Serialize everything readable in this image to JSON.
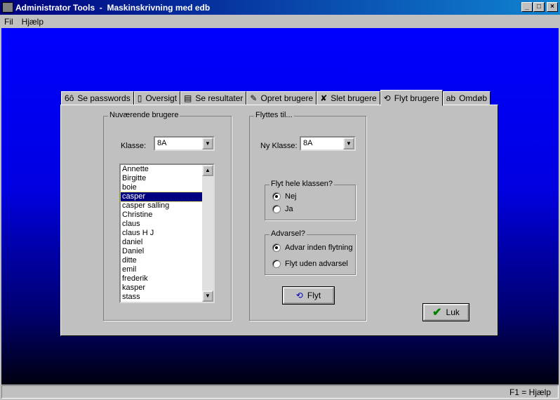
{
  "window": {
    "title": "Administrator Tools  -  Maskinskrivning med edb",
    "min": "_",
    "max": "□",
    "close": "×"
  },
  "menu": [
    "Fil",
    "Hjælp"
  ],
  "tabs": [
    {
      "label": "Se passwords",
      "icon": "glasses-icon",
      "glyph": "6ô"
    },
    {
      "label": "Oversigt",
      "icon": "document-icon",
      "glyph": "▯"
    },
    {
      "label": "Se resultater",
      "icon": "book-icon",
      "glyph": "▤"
    },
    {
      "label": "Opret brugere",
      "icon": "pencil-icon",
      "glyph": "✎"
    },
    {
      "label": "Slet brugere",
      "icon": "delete-x-icon",
      "glyph": "✘"
    },
    {
      "label": "Flyt brugere",
      "icon": "move-arrows-icon",
      "glyph": "⟲"
    },
    {
      "label": "Omdøb",
      "icon": "rename-icon",
      "glyph": "ab"
    }
  ],
  "current": {
    "title": "Nuværende brugere",
    "klasse_label": "Klasse:",
    "klasse_value": "8A",
    "users": [
      "Annette",
      "Birgitte",
      "boie",
      "casper",
      "casper salling",
      "Christine",
      "claus",
      "claus H J",
      "daniel",
      "Daniel",
      "ditte",
      "emil",
      "frederik",
      "kasper",
      "stass"
    ],
    "selected": "casper"
  },
  "target": {
    "title": "Flyttes til...",
    "ny_klasse_label": "Ny Klasse:",
    "ny_klasse_value": "8A",
    "whole_title": "Flyt hele klassen?",
    "whole_options": [
      "Nej",
      "Ja"
    ],
    "whole_selected": "Nej",
    "warn_title": "Advarsel?",
    "warn_options": [
      "Advar inden flytning",
      "Flyt uden advarsel"
    ],
    "warn_selected": "Advar inden flytning",
    "move_button": "Flyt"
  },
  "close_button": "Luk",
  "status": "F1 = Hjælp",
  "colors": {
    "selection": "#000080",
    "title": "#000080",
    "check": "#008000"
  }
}
